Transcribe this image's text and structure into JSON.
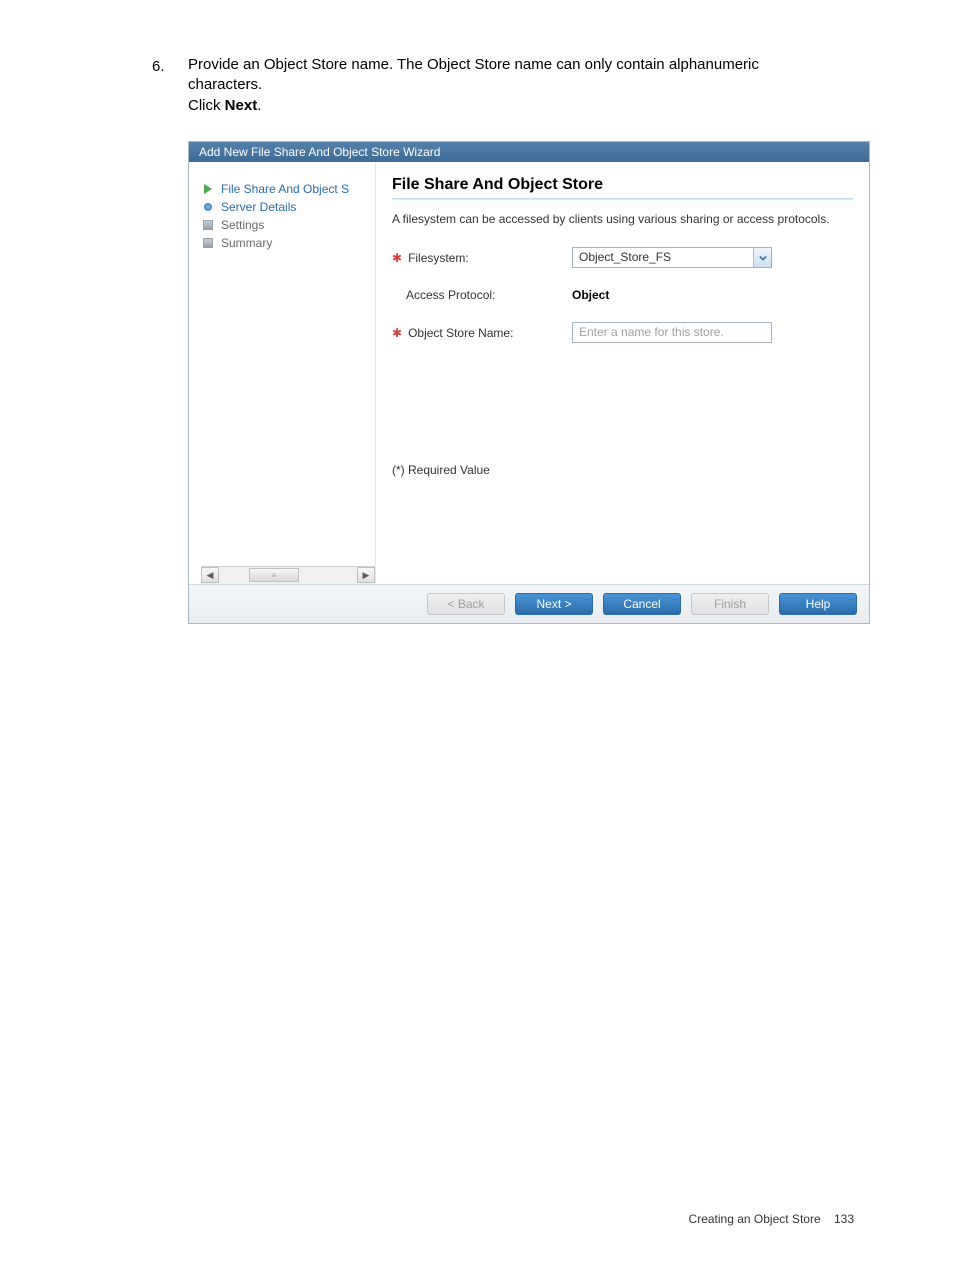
{
  "step": {
    "number": "6.",
    "line1_a": "Provide an Object Store name. The Object Store name can only contain alphanumeric",
    "line1_b": "characters.",
    "line2_a": "Click ",
    "line2_b": "Next",
    "line2_c": "."
  },
  "wizard": {
    "title": "Add New File Share And Object Store Wizard",
    "nav": {
      "item1": "File Share And Object S",
      "item2": "Server Details",
      "item3": "Settings",
      "item4": "Summary"
    },
    "content": {
      "title": "File Share And Object Store",
      "description": "A filesystem can be accessed by clients using various sharing or access protocols.",
      "filesystem_label": "Filesystem:",
      "filesystem_value": "Object_Store_FS",
      "access_label": "Access Protocol:",
      "access_value": "Object",
      "storename_label": "Object Store Name:",
      "storename_placeholder": "Enter a name for this store.",
      "required_note": "(*) Required Value"
    },
    "buttons": {
      "back": "< Back",
      "next": "Next >",
      "cancel": "Cancel",
      "finish": "Finish",
      "help": "Help"
    }
  },
  "footer": {
    "text": "Creating an Object Store",
    "page": "133"
  }
}
